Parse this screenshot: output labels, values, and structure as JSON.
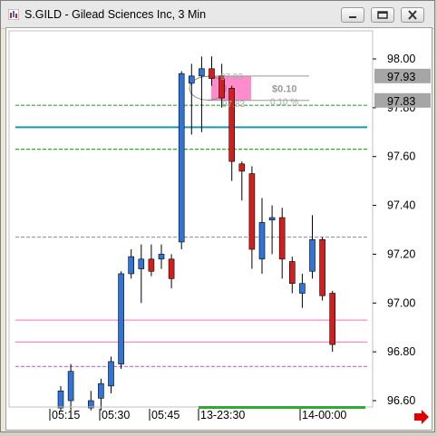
{
  "window": {
    "title": "S.GILD - Gilead Sciences Inc, 3 Min",
    "icons": {
      "app": "app-chart-icon",
      "minimize": "minimize-icon",
      "restore": "restore-icon",
      "close": "close-icon",
      "scroll": "scroll-right-arrow-icon"
    }
  },
  "colors": {
    "up": "#2f74d6",
    "down": "#d41e1e",
    "teal": "#1a9aa8",
    "green": "#2faa2f",
    "pink": "#ff88cc",
    "magenta_dash": "#cc66cc",
    "grey_dash": "#999999"
  },
  "chart_data": {
    "type": "candlestick",
    "symbol": "S.GILD",
    "interval": "3 Min",
    "ylim": [
      96.56,
      98.06
    ],
    "y_ticks": [
      "98.00",
      "97.80",
      "97.60",
      "97.40",
      "97.20",
      "97.00",
      "96.80",
      "96.60"
    ],
    "x_ticks": [
      "05:15",
      "05:30",
      "05:45",
      "13-23:30",
      "14-00:00"
    ],
    "price_markers": [
      {
        "label": "97.93",
        "value": 97.93
      },
      {
        "label": "97.83",
        "value": 97.83
      }
    ],
    "candles": [
      {
        "t": 1,
        "open": 96.57,
        "high": 96.66,
        "low": 96.56,
        "close": 96.64,
        "dir": "up"
      },
      {
        "t": 2,
        "open": 96.6,
        "high": 96.75,
        "low": 96.56,
        "close": 96.72,
        "dir": "up"
      },
      {
        "t": 4,
        "open": 96.57,
        "high": 96.64,
        "low": 96.56,
        "close": 96.6,
        "dir": "up"
      },
      {
        "t": 5,
        "open": 96.61,
        "high": 96.69,
        "low": 96.56,
        "close": 96.67,
        "dir": "up"
      },
      {
        "t": 6,
        "open": 96.66,
        "high": 96.78,
        "low": 96.63,
        "close": 96.76,
        "dir": "up"
      },
      {
        "t": 7,
        "open": 96.75,
        "high": 97.13,
        "low": 96.73,
        "close": 97.12,
        "dir": "up"
      },
      {
        "t": 8,
        "open": 97.12,
        "high": 97.22,
        "low": 97.1,
        "close": 97.19,
        "dir": "up"
      },
      {
        "t": 9,
        "open": 97.14,
        "high": 97.24,
        "low": 97.0,
        "close": 97.18,
        "dir": "up"
      },
      {
        "t": 10,
        "open": 97.18,
        "high": 97.24,
        "low": 97.11,
        "close": 97.13,
        "dir": "down"
      },
      {
        "t": 11,
        "open": 97.18,
        "high": 97.24,
        "low": 97.14,
        "close": 97.2,
        "dir": "up"
      },
      {
        "t": 12,
        "open": 97.18,
        "high": 97.2,
        "low": 97.06,
        "close": 97.1,
        "dir": "down"
      },
      {
        "t": 13,
        "open": 97.25,
        "high": 97.95,
        "low": 97.22,
        "close": 97.94,
        "dir": "up"
      },
      {
        "t": 14,
        "open": 97.9,
        "high": 97.98,
        "low": 97.69,
        "close": 97.93,
        "dir": "up"
      },
      {
        "t": 15,
        "open": 97.93,
        "high": 98.01,
        "low": 97.7,
        "close": 97.96,
        "dir": "up"
      },
      {
        "t": 16,
        "open": 97.96,
        "high": 98.01,
        "low": 97.89,
        "close": 97.92,
        "dir": "down"
      },
      {
        "t": 17,
        "open": 97.93,
        "high": 97.98,
        "low": 97.8,
        "close": 97.84,
        "dir": "down"
      },
      {
        "t": 18,
        "open": 97.88,
        "high": 97.89,
        "low": 97.5,
        "close": 97.58,
        "dir": "down"
      },
      {
        "t": 19,
        "open": 97.57,
        "high": 97.58,
        "low": 97.42,
        "close": 97.54,
        "dir": "down"
      },
      {
        "t": 20,
        "open": 97.53,
        "high": 97.56,
        "low": 97.14,
        "close": 97.22,
        "dir": "down"
      },
      {
        "t": 21,
        "open": 97.18,
        "high": 97.43,
        "low": 97.12,
        "close": 97.33,
        "dir": "up"
      },
      {
        "t": 22,
        "open": 97.35,
        "high": 97.4,
        "low": 97.2,
        "close": 97.34,
        "dir": "up"
      },
      {
        "t": 23,
        "open": 97.35,
        "high": 97.39,
        "low": 97.1,
        "close": 97.18,
        "dir": "down"
      },
      {
        "t": 24,
        "open": 97.17,
        "high": 97.19,
        "low": 97.04,
        "close": 97.08,
        "dir": "down"
      },
      {
        "t": 25,
        "open": 97.04,
        "high": 97.12,
        "low": 96.98,
        "close": 97.08,
        "dir": "up"
      },
      {
        "t": 26,
        "open": 97.13,
        "high": 97.36,
        "low": 97.1,
        "close": 97.26,
        "dir": "up"
      },
      {
        "t": 27,
        "open": 97.26,
        "high": 97.27,
        "low": 97.01,
        "close": 97.03,
        "dir": "down"
      },
      {
        "t": 28,
        "open": 97.04,
        "high": 97.05,
        "low": 96.8,
        "close": 96.83,
        "dir": "down"
      }
    ],
    "overlay_lines": [
      {
        "name": "level-teal",
        "value": 97.72,
        "color": "#1a9aa8",
        "style": "solid"
      },
      {
        "name": "level-green-upper",
        "value": 97.81,
        "color": "#2faa2f",
        "style": "dashed"
      },
      {
        "name": "level-green-lower",
        "value": 97.63,
        "color": "#2faa2f",
        "style": "dashed"
      },
      {
        "name": "level-grey",
        "value": 97.27,
        "color": "#999999",
        "style": "dashed"
      },
      {
        "name": "level-pink-upper",
        "value": 96.93,
        "color": "#ff88cc",
        "style": "solid"
      },
      {
        "name": "level-pink-mid",
        "value": 96.84,
        "color": "#ff88cc",
        "style": "solid"
      },
      {
        "name": "level-magenta-lower",
        "value": 96.74,
        "color": "#cc66cc",
        "style": "dashed"
      }
    ],
    "measure_box": {
      "top_label": "97.93",
      "bottom_label": "97.83",
      "price_diff": "$0.10",
      "percent_diff": "0.10 %"
    }
  }
}
